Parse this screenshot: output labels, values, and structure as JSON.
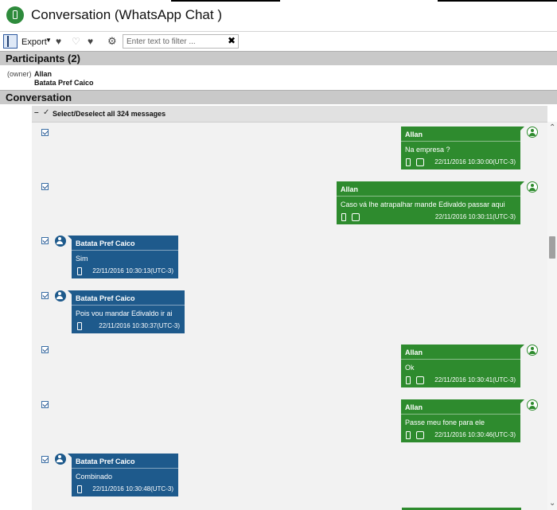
{
  "window": {
    "title": "Conversation (WhatsApp Chat )"
  },
  "toolbar": {
    "export_label": "Export",
    "export_caret": "▼",
    "filter_placeholder": "Enter text to filter ...",
    "clear_glyph": "✖",
    "tag_icon": "♥",
    "untag_icon": "♡",
    "tag_alt_icon": "♥",
    "settings_icon": "⚙"
  },
  "participants": {
    "header": "Participants (2)",
    "owner_tag": "(owner)",
    "list": [
      "Allan",
      "Batata Pref Caico"
    ]
  },
  "conversation": {
    "header": "Conversation",
    "collapse_glyph": "–",
    "check_glyph": "✓",
    "select_all_label": "Select/Deselect all 324 messages",
    "messages": [
      {
        "sender": "Allan",
        "text": "Na empresa ?",
        "timestamp": "22/11/2016 10:30:00(UTC-3)",
        "side": "right"
      },
      {
        "sender": "Allan",
        "text": "Caso vá lhe atrapalhar mande Edivaldo passar aqui",
        "timestamp": "22/11/2016 10:30:11(UTC-3)",
        "side": "right"
      },
      {
        "sender": "Batata Pref Caico",
        "text": "Sim",
        "timestamp": "22/11/2016 10:30:13(UTC-3)",
        "side": "left"
      },
      {
        "sender": "Batata Pref Caico",
        "text": "Pois vou mandar Edivaldo ir ai",
        "timestamp": "22/11/2016 10:30:37(UTC-3)",
        "side": "left"
      },
      {
        "sender": "Allan",
        "text": "Ok",
        "timestamp": "22/11/2016 10:30:41(UTC-3)",
        "side": "right"
      },
      {
        "sender": "Allan",
        "text": "Passe meu fone para ele",
        "timestamp": "22/11/2016 10:30:46(UTC-3)",
        "side": "right"
      },
      {
        "sender": "Batata Pref Caico",
        "text": "Combinado",
        "timestamp": "22/11/2016 10:30:48(UTC-3)",
        "side": "left"
      }
    ]
  },
  "scrollbar": {
    "up_glyph": "⌃",
    "down_glyph": "⌄"
  },
  "colors": {
    "outgoing": "#2e8b2e",
    "incoming": "#1e5a8c",
    "section": "#c9c9c9"
  }
}
